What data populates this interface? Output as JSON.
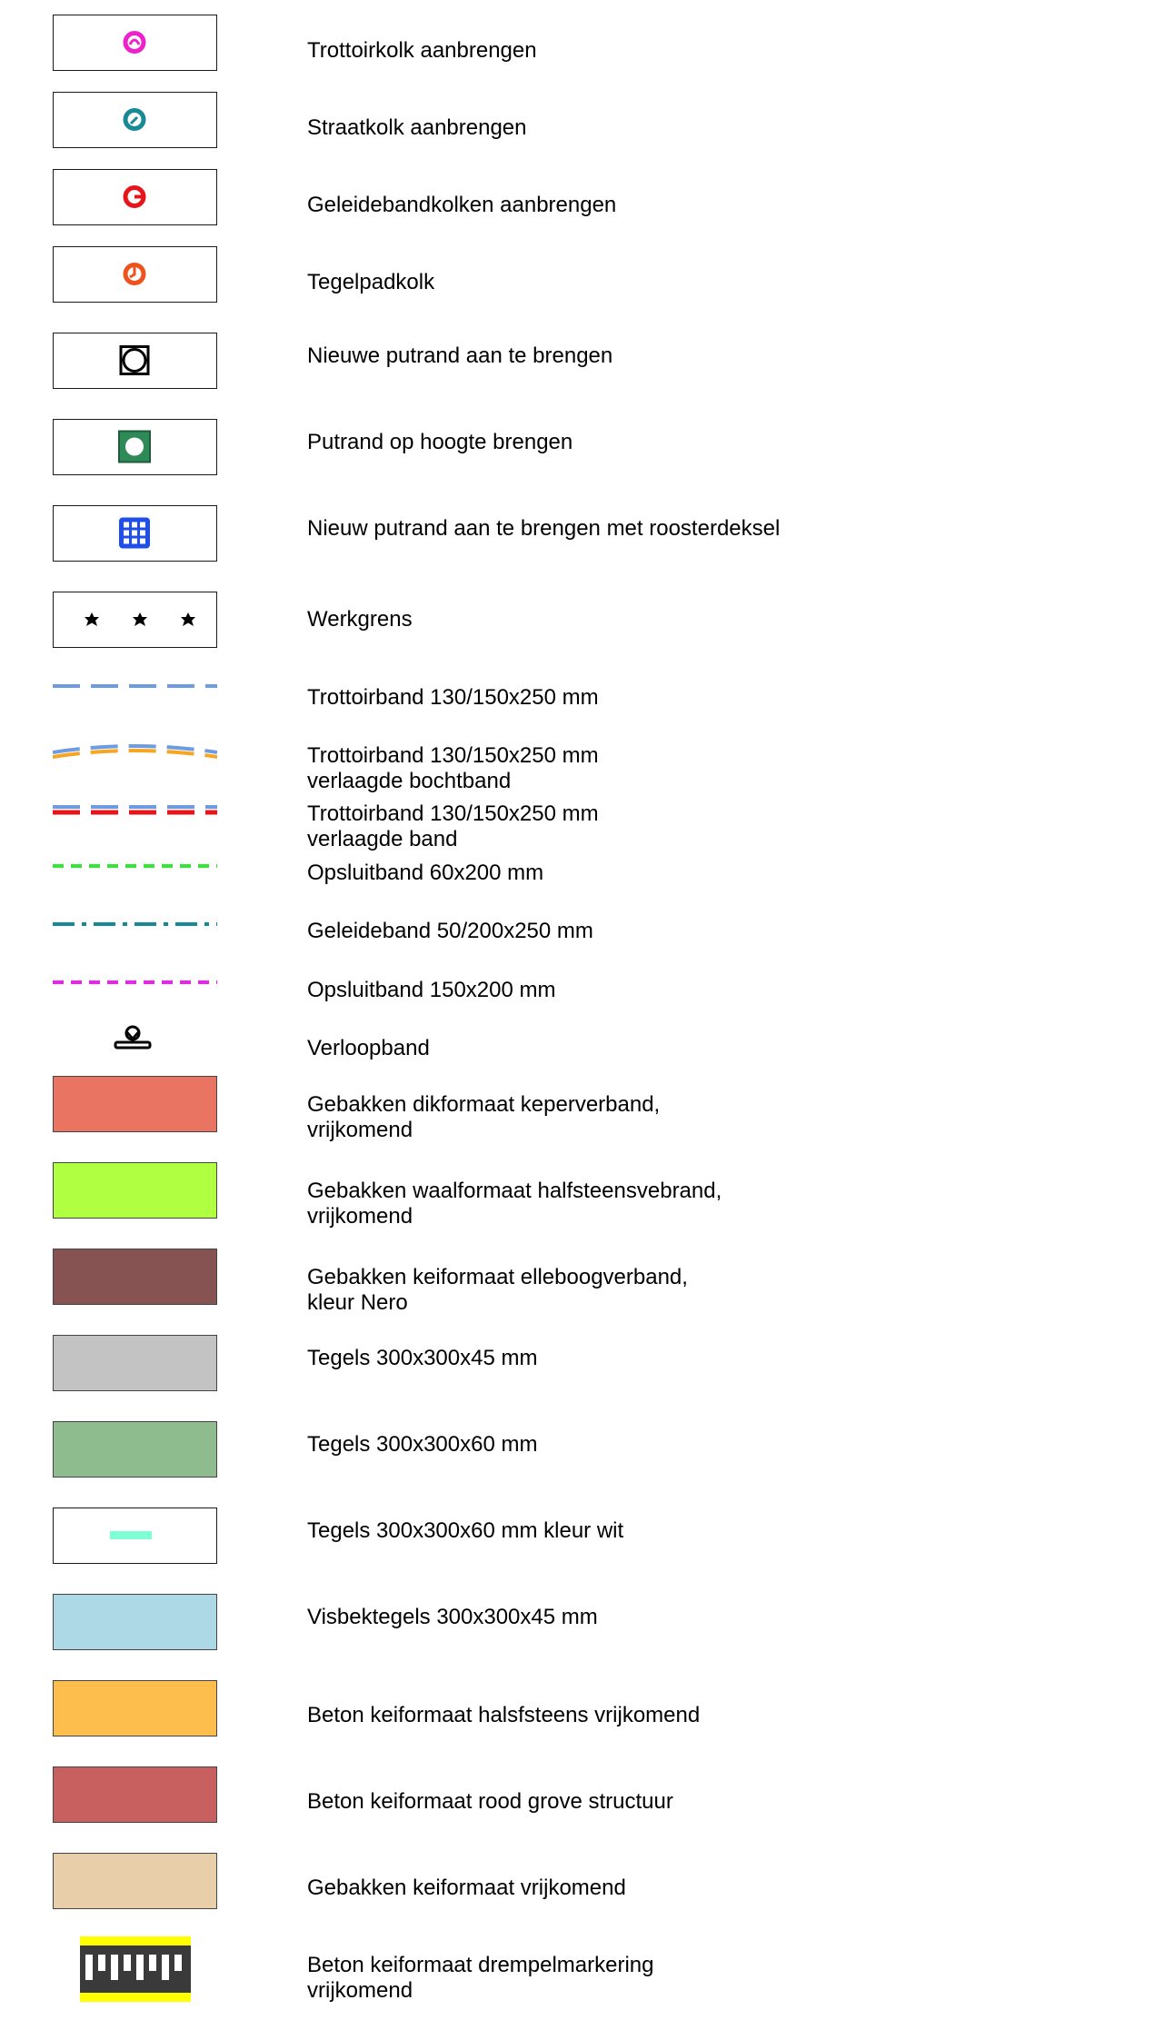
{
  "legend": {
    "items": [
      {
        "lines": [
          "Trottoirkolk aanbrengen"
        ],
        "icon": "trottoirkolk-icon",
        "color": "#ee22cc"
      },
      {
        "lines": [
          "Straatkolk aanbrengen"
        ],
        "icon": "straatkolk-icon",
        "color": "#178a96"
      },
      {
        "lines": [
          "Geleidebandkolken aanbrengen"
        ],
        "icon": "geleidebandkolk-icon",
        "color": "#e8141c"
      },
      {
        "lines": [
          "Tegelpadkolk"
        ],
        "icon": "tegelpadkolk-icon",
        "color": "#f0521e"
      },
      {
        "lines": [
          "Nieuwe putrand aan te brengen"
        ],
        "icon": "putrand-new-icon",
        "color": "#000000"
      },
      {
        "lines": [
          "Putrand op hoogte brengen"
        ],
        "icon": "putrand-height-icon",
        "color": "#2e8b57"
      },
      {
        "lines": [
          "Nieuw putrand aan te brengen met roosterdeksel"
        ],
        "icon": "putrand-grate-icon",
        "color": "#1f4ee8"
      },
      {
        "lines": [
          "Werkgrens"
        ],
        "icon": "werkgrens-stars-icon",
        "color": "#000000"
      },
      {
        "lines": [
          "Trottoirband 130/150x250 mm"
        ],
        "icon": "dashed-line-blue",
        "color": "#6f9be0"
      },
      {
        "lines": [
          "Trottoirband 130/150x250 mm",
          "verlaagde bochtband"
        ],
        "icon": "dashed-line-blue-orange",
        "color": "#f5a623"
      },
      {
        "lines": [
          "Trottoirband 130/150x250 mm",
          "verlaagde band"
        ],
        "icon": "dashed-line-blue-red",
        "color": "#e8141c"
      },
      {
        "lines": [
          "Opsluitband 60x200 mm"
        ],
        "icon": "dotted-line-green",
        "color": "#33e833"
      },
      {
        "lines": [
          "Geleideband 50/200x250 mm"
        ],
        "icon": "dashdot-line-teal",
        "color": "#178a96"
      },
      {
        "lines": [
          "Opsluitband 150x200 mm"
        ],
        "icon": "dotted-line-magenta",
        "color": "#ee22ee"
      },
      {
        "lines": [
          "Verloopband"
        ],
        "icon": "verloopband-icon",
        "color": "#000000"
      },
      {
        "lines": [
          "Gebakken dikformaat keperverband,",
          "vrijkomend"
        ],
        "icon": "swatch",
        "color": "#e87461"
      },
      {
        "lines": [
          "Gebakken waalformaat halfsteensvebrand,",
          "vrijkomend"
        ],
        "icon": "swatch",
        "color": "#b0ff40"
      },
      {
        "lines": [
          "Gebakken keiformaat elleboogverband,",
          "kleur Nero"
        ],
        "icon": "swatch",
        "color": "#875252"
      },
      {
        "lines": [
          "Tegels 300x300x45 mm"
        ],
        "icon": "swatch",
        "color": "#c3c3c3"
      },
      {
        "lines": [
          "Tegels 300x300x60 mm"
        ],
        "icon": "swatch",
        "color": "#8fbc8f"
      },
      {
        "lines": [
          "Tegels 300x300x60 mm kleur wit"
        ],
        "icon": "swatch-white-dash",
        "color": "#7fffd4"
      },
      {
        "lines": [
          "Visbektegels 300x300x45 mm"
        ],
        "icon": "swatch",
        "color": "#add8e6"
      },
      {
        "lines": [
          "Beton keiformaat halsfsteens vrijkomend"
        ],
        "icon": "swatch",
        "color": "#fdbe4e"
      },
      {
        "lines": [
          "Beton keiformaat rood grove structuur"
        ],
        "icon": "swatch",
        "color": "#c86060"
      },
      {
        "lines": [
          "Gebakken keiformaat vrijkomend"
        ],
        "icon": "swatch",
        "color": "#e8cfaa"
      },
      {
        "lines": [
          "Beton keiformaat drempelmarkering",
          "vrijkomend"
        ],
        "icon": "drempelmarkering-icon",
        "color": "#ffff00"
      }
    ]
  }
}
